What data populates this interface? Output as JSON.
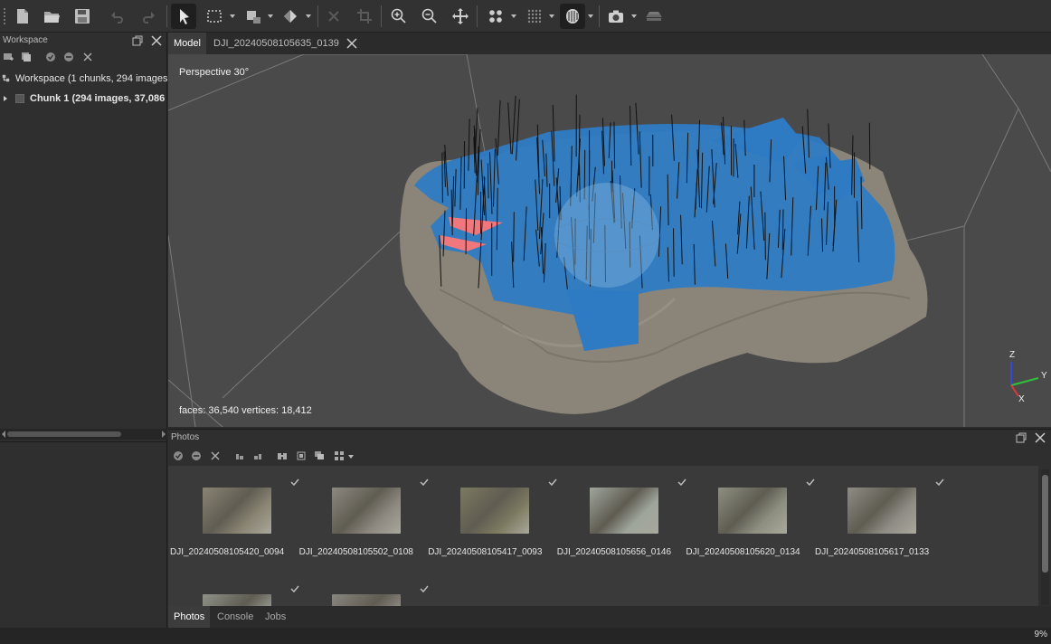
{
  "toolbar": {
    "buttons": [
      "new-document",
      "open-folder",
      "save",
      "undo",
      "redo",
      "navigation-select",
      "rectangle-selection",
      "resize-region",
      "rotate-region",
      "delete-selection",
      "crop-selection",
      "zoom-in",
      "zoom-out",
      "reset-view",
      "show-points",
      "show-cameras",
      "model-shading",
      "capture-view",
      "model-layers"
    ]
  },
  "workspace": {
    "title": "Workspace",
    "tree": {
      "root_label": "Workspace (1 chunks, 294 images)",
      "chunk_label": "Chunk 1 (294 images, 37,086"
    }
  },
  "tabs": [
    {
      "label": "Model",
      "active": true
    },
    {
      "label": "DJI_20240508105635_0139",
      "active": false
    }
  ],
  "viewport": {
    "perspective_label": "Perspective 30°",
    "stats_label": "faces: 36,540 vertices: 18,412",
    "axes": {
      "z": "Z",
      "y": "Y",
      "x": "X"
    }
  },
  "photos_panel": {
    "title": "Photos",
    "photos": [
      {
        "name": "DJI_20240508105420_0094",
        "checked": true,
        "tone": "#8a8472"
      },
      {
        "name": "DJI_20240508105502_0108",
        "checked": true,
        "tone": "#8c8880"
      },
      {
        "name": "DJI_20240508105417_0093",
        "checked": true,
        "tone": "#7c7a60"
      },
      {
        "name": "DJI_20240508105656_0146",
        "checked": true,
        "tone": "#9fa59c"
      },
      {
        "name": "DJI_20240508105620_0134",
        "checked": true,
        "tone": "#8d8f80"
      },
      {
        "name": "DJI_20240508105617_0133",
        "checked": true,
        "tone": "#8e8c84"
      },
      {
        "name": "",
        "checked": true,
        "tone": "#8f9288"
      },
      {
        "name": "",
        "checked": true,
        "tone": "#8a8680"
      }
    ]
  },
  "bottom_tabs": [
    {
      "label": "Photos",
      "active": true
    },
    {
      "label": "Console",
      "active": false
    },
    {
      "label": "Jobs",
      "active": false
    }
  ],
  "status": {
    "progress_label": "9%"
  },
  "colors": {
    "accent_blue": "#2e7bc4",
    "camera_pink": "#f0787c",
    "terrain": "#8a857b",
    "viewport_bg": "#4a4a4a"
  }
}
